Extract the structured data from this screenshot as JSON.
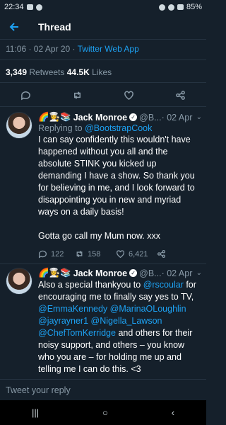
{
  "status": {
    "time": "22:34",
    "battery": "85%"
  },
  "header": {
    "back_icon": "arrow-left-icon",
    "title": "Thread"
  },
  "tweet_meta": {
    "time": "11:06 · 02 Apr 20 · ",
    "source": "Twitter Web App"
  },
  "stats": {
    "retweets": "3,349",
    "retweets_label": " Retweets  ",
    "likes": "44.5K",
    "likes_label": " Likes"
  },
  "replies": [
    {
      "emojis": "🌈👩‍🍳📚",
      "name": "Jack Monroe",
      "handle": "@B...",
      "date": " · 02 Apr",
      "replying_prefix": "Replying to ",
      "replying_to": "@BootstrapCook",
      "text": "I can say confidently this wouldn't have happened without you all and the absolute STINK you kicked up demanding I have a show. So thank you for believing in me, and I look forward to disappointing you in new and myriad ways on a daily basis!\n\nGotta go call my Mum now. xxx",
      "reply_count": "122",
      "retweet_count": "158",
      "like_count": "6,421"
    },
    {
      "emojis": "🌈👩‍🍳📚",
      "name": "Jack Monroe",
      "handle": "@B...",
      "date": " · 02 Apr",
      "text_parts": [
        {
          "t": "Also a special thankyou to ",
          "m": false
        },
        {
          "t": "@rscoular",
          "m": true
        },
        {
          "t": " for encouraging me to finally say yes to TV, ",
          "m": false
        },
        {
          "t": "@EmmaKennedy",
          "m": true
        },
        {
          "t": " ",
          "m": false
        },
        {
          "t": "@MarinaOLoughlin",
          "m": true
        },
        {
          "t": " ",
          "m": false
        },
        {
          "t": "@jayrayner1",
          "m": true
        },
        {
          "t": " ",
          "m": false
        },
        {
          "t": "@Nigella_Lawson",
          "m": true
        },
        {
          "t": " ",
          "m": false
        },
        {
          "t": "@ChefTomKerridge",
          "m": true
        },
        {
          "t": " and others for their noisy support, and others – you know who you are – for holding me up and telling me I can do this. <3",
          "m": false
        }
      ]
    }
  ],
  "composer": {
    "placeholder": "Tweet your reply"
  },
  "navbar": {
    "recent": "|||",
    "home": "○",
    "back": "‹"
  }
}
